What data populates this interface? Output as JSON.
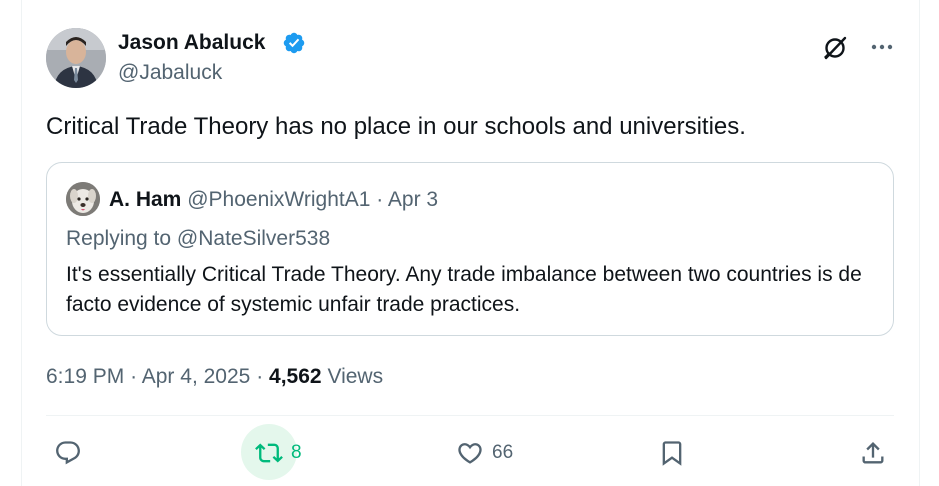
{
  "author": {
    "name": "Jason Abaluck",
    "handle": "@Jabaluck"
  },
  "tweet": {
    "text": "Critical Trade Theory has no place in our schools and universities."
  },
  "quote": {
    "name": "A. Ham",
    "handle": "@PhoenixWrightA1",
    "separator": "·",
    "date": "Apr 3",
    "reply_prefix": "Replying to ",
    "reply_to": "@NateSilver538",
    "text": "It's essentially Critical Trade Theory. Any trade imbalance between two countries is de facto evidence of systemic unfair trade practices."
  },
  "meta": {
    "time": "6:19 PM",
    "separator": "·",
    "date": "Apr 4, 2025",
    "views_count": "4,562",
    "views_label": "Views"
  },
  "actions": {
    "retweets": "8",
    "likes": "66"
  },
  "colors": {
    "verified": "#1d9bf0",
    "retweet_active": "#00ba7c",
    "secondary_text": "#536471"
  },
  "icons": [
    "verified-badge-icon",
    "grok-icon",
    "more-icon",
    "reply-icon",
    "retweet-icon",
    "like-icon",
    "bookmark-icon",
    "share-icon"
  ]
}
